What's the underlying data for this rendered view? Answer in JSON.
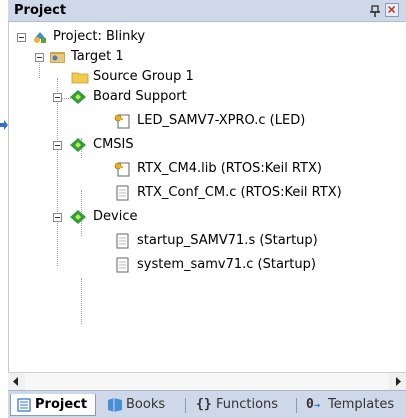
{
  "window": {
    "title": "Project"
  },
  "tree": {
    "project": "Project: Blinky",
    "target": "Target 1",
    "source_group": "Source Group 1",
    "board_support": "Board Support",
    "led_file": "LED_SAMV7-XPRO.c (LED)",
    "cmsis": "CMSIS",
    "rtx_lib": "RTX_CM4.lib (RTOS:Keil RTX)",
    "rtx_conf": "RTX_Conf_CM.c (RTOS:Keil RTX)",
    "device": "Device",
    "startup_file": "startup_SAMV71.s (Startup)",
    "system_file": "system_samv71.c (Startup)"
  },
  "tabs": {
    "project": "Project",
    "books": "Books",
    "functions": "Functions",
    "templates": "Templates"
  },
  "icons": {
    "pin": "pin-icon",
    "close": "close-icon",
    "project": "project-icon",
    "target": "target-icon",
    "folder": "folder-icon",
    "component": "component-icon",
    "file": "file-icon",
    "config_file": "config-file-icon"
  }
}
